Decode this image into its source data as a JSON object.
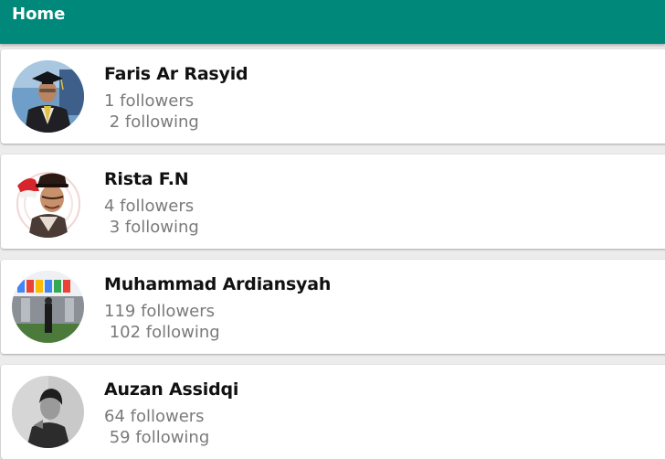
{
  "app": {
    "title": "Home",
    "accent_color": "#00897b"
  },
  "users": [
    {
      "name": "Faris Ar Rasyid",
      "followers": "1 followers",
      "following": " 2 following",
      "avatar_icon": "graduate-portrait-avatar"
    },
    {
      "name": "Rista F.N",
      "followers": "4 followers",
      "following": " 3 following",
      "avatar_icon": "hat-illustration-avatar"
    },
    {
      "name": "Muhammad Ardiansyah",
      "followers": "119 followers",
      "following": " 102 following",
      "avatar_icon": "google-office-avatar"
    },
    {
      "name": "Auzan Assidqi",
      "followers": "64 followers",
      "following": " 59 following",
      "avatar_icon": "monochrome-portrait-avatar"
    }
  ]
}
